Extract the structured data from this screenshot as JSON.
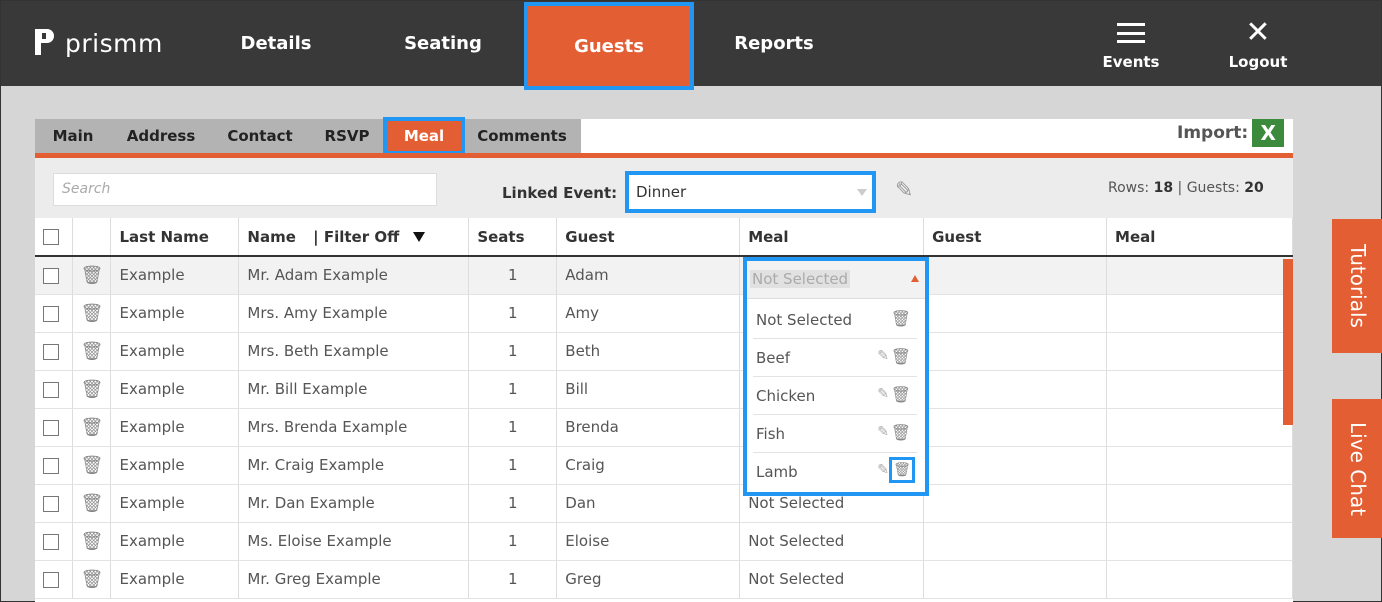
{
  "brand": {
    "name": "prismm"
  },
  "nav": {
    "details": "Details",
    "seating": "Seating",
    "guests": "Guests",
    "reports": "Reports",
    "events": "Events",
    "logout": "Logout"
  },
  "subtabs": [
    "Main",
    "Address",
    "Contact",
    "RSVP",
    "Meal",
    "Comments"
  ],
  "import_label": "Import:",
  "toolbar": {
    "search_placeholder": "Search",
    "linked_event_label": "Linked Event:",
    "linked_event_value": "Dinner",
    "rows_label": "Rows:",
    "rows_value": "18",
    "guests_label": "Guests:",
    "guests_value": "20"
  },
  "table": {
    "headers": {
      "last_name": "Last Name",
      "name": "Name",
      "filter": "Filter Off",
      "seats": "Seats",
      "guest": "Guest",
      "meal": "Meal",
      "guest2": "Guest",
      "meal2": "Meal"
    },
    "rows": [
      {
        "last": "Example",
        "name": "Mr. Adam Example",
        "seats": "1",
        "guest": "Adam",
        "meal": ""
      },
      {
        "last": "Example",
        "name": "Mrs. Amy Example",
        "seats": "1",
        "guest": "Amy",
        "meal": ""
      },
      {
        "last": "Example",
        "name": "Mrs. Beth Example",
        "seats": "1",
        "guest": "Beth",
        "meal": ""
      },
      {
        "last": "Example",
        "name": "Mr. Bill Example",
        "seats": "1",
        "guest": "Bill",
        "meal": ""
      },
      {
        "last": "Example",
        "name": "Mrs. Brenda Example",
        "seats": "1",
        "guest": "Brenda",
        "meal": ""
      },
      {
        "last": "Example",
        "name": "Mr. Craig Example",
        "seats": "1",
        "guest": "Craig",
        "meal": ""
      },
      {
        "last": "Example",
        "name": "Mr. Dan Example",
        "seats": "1",
        "guest": "Dan",
        "meal": "Not Selected"
      },
      {
        "last": "Example",
        "name": "Ms. Eloise Example",
        "seats": "1",
        "guest": "Eloise",
        "meal": "Not Selected"
      },
      {
        "last": "Example",
        "name": "Mr. Greg Example",
        "seats": "1",
        "guest": "Greg",
        "meal": "Not Selected"
      }
    ]
  },
  "meal_dropdown": {
    "selected": "Not Selected",
    "options": [
      "Not Selected",
      "Beef",
      "Chicken",
      "Fish",
      "Lamb"
    ]
  },
  "side_tabs": {
    "tutorials": "Tutorials",
    "live_chat": "Live Chat"
  },
  "colors": {
    "accent": "#e45e33",
    "highlight": "#2196f3",
    "nav_bg": "#393939"
  }
}
